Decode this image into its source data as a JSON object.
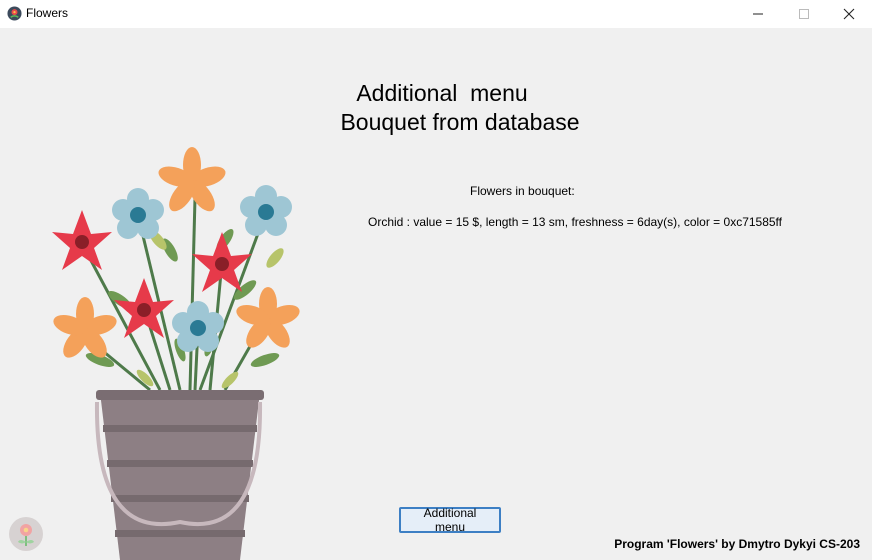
{
  "window": {
    "title": "Flowers",
    "controls": [
      "minimize-icon",
      "maximize-icon",
      "close-icon"
    ]
  },
  "main": {
    "heading_line1": "Additional  menu",
    "heading_line2": "Bouquet from database",
    "bouquet_label": "Flowers in bouquet:",
    "flowers": [
      "Orchid : value = 15 $, length = 13 sm, freshness = 6day(s), color = 0xc71585ff"
    ]
  },
  "footer": {
    "button_label": "Additional menu",
    "credit": "Program 'Flowers' by Dmytro Dykyi CS-203"
  },
  "colors": {
    "red_flower": "#e63a4a",
    "orange_flower": "#f4a15a",
    "blue_flower": "#9ec6d4",
    "bucket": "#8d7f84",
    "accent": "#3d7fc4"
  }
}
